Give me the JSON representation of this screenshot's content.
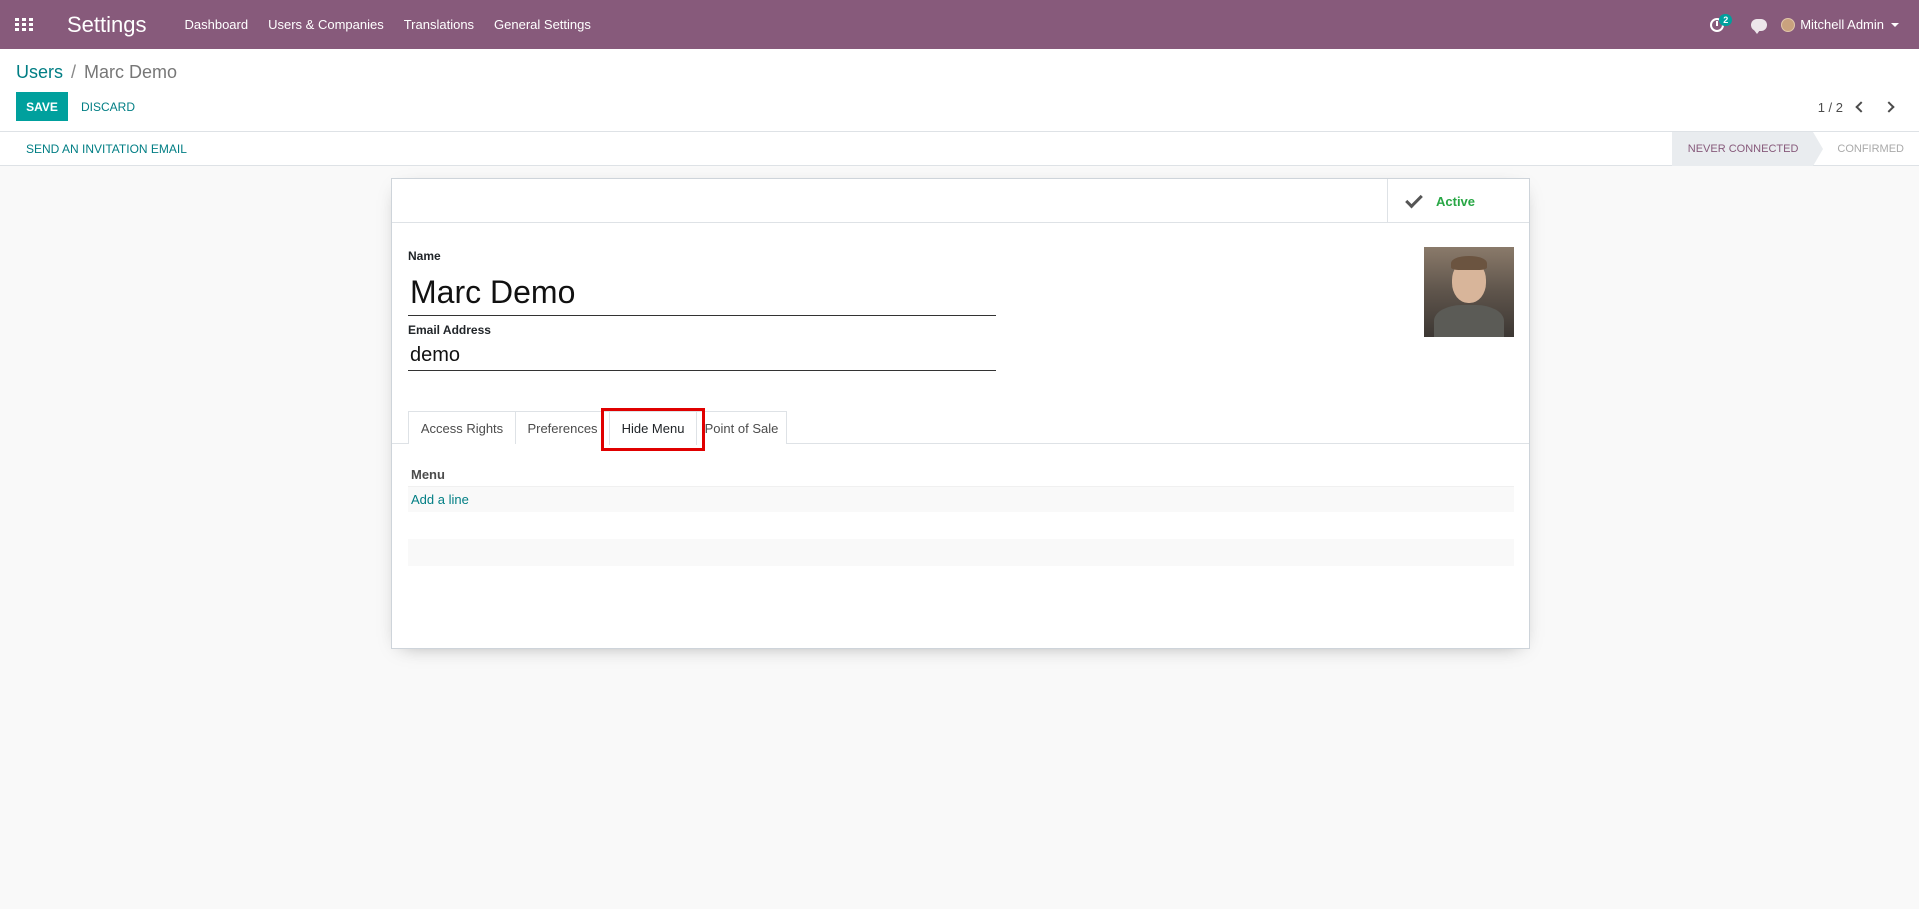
{
  "nav": {
    "brand": "Settings",
    "menu": [
      "Dashboard",
      "Users & Companies",
      "Translations",
      "General Settings"
    ],
    "activity_count": "2",
    "user": "Mitchell Admin"
  },
  "breadcrumb": {
    "parent": "Users",
    "separator": "/",
    "current": "Marc Demo"
  },
  "actions": {
    "save": "SAVE",
    "discard": "DISCARD"
  },
  "pager": {
    "value": "1 / 2"
  },
  "statusbar": {
    "invite": "SEND AN INVITATION EMAIL",
    "stages": [
      "NEVER CONNECTED",
      "CONFIRMED"
    ],
    "active_stage": "NEVER CONNECTED"
  },
  "form": {
    "active_label": "Active",
    "name_label": "Name",
    "name_value": "Marc Demo",
    "email_label": "Email Address",
    "email_value": "demo",
    "tabs": [
      "Access Rights",
      "Preferences",
      "Hide Menu",
      "Point of Sale"
    ],
    "active_tab": "Hide Menu",
    "table": {
      "column": "Menu",
      "add_line": "Add a line"
    }
  },
  "colors": {
    "brand": "#875a7b",
    "accent": "#00a09d",
    "link": "#017e84",
    "active_green": "#28a745",
    "highlight": "#e00000"
  }
}
